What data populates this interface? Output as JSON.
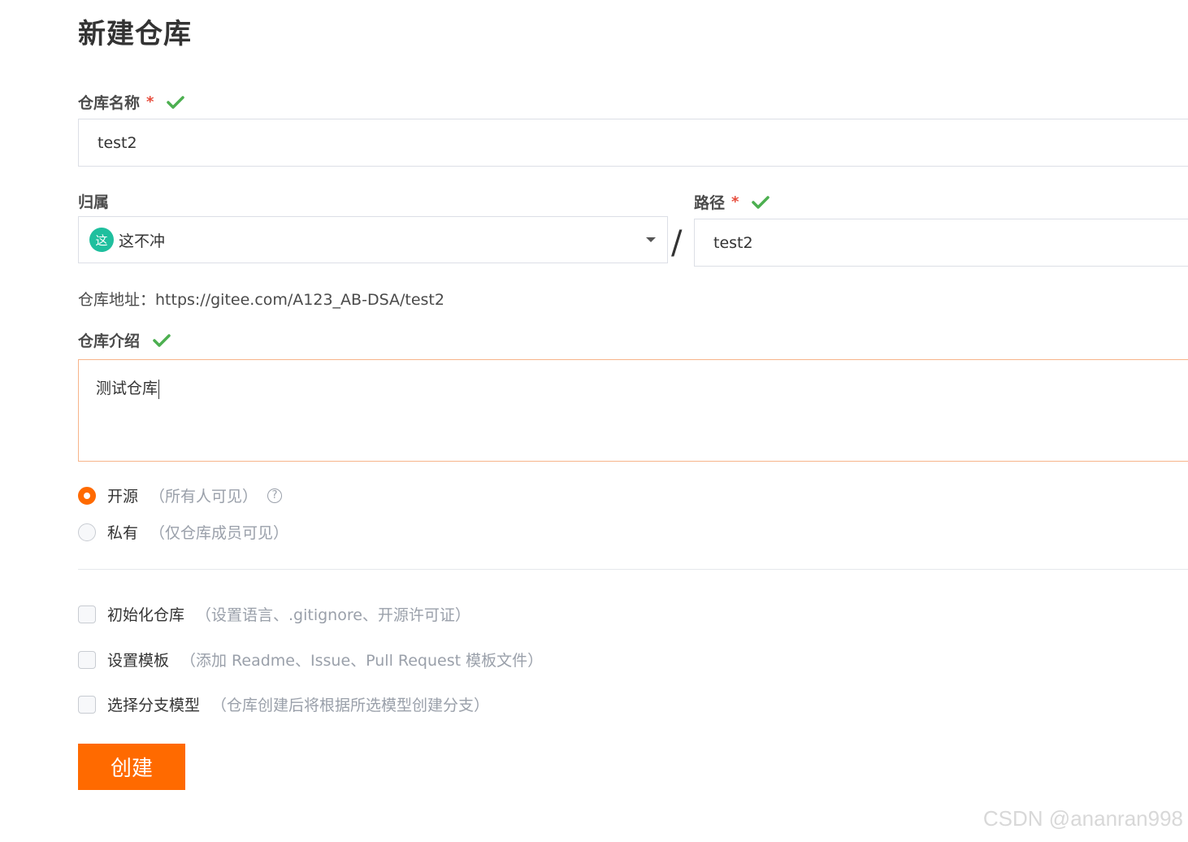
{
  "page": {
    "title": "新建仓库"
  },
  "repo_name": {
    "label": "仓库名称",
    "required_mark": "*",
    "value": "test2"
  },
  "owner": {
    "label": "归属",
    "avatar_text": "这",
    "value": "这不冲"
  },
  "separator": "/",
  "path": {
    "label": "路径",
    "required_mark": "*",
    "value": "test2"
  },
  "address": {
    "text": "仓库地址：https://gitee.com/A123_AB-DSA/test2"
  },
  "description": {
    "label": "仓库介绍",
    "value": "测试仓库"
  },
  "visibility": {
    "options": [
      {
        "label": "开源",
        "hint": "（所有人可见）",
        "selected": true,
        "help_icon": "question-circle-icon"
      },
      {
        "label": "私有",
        "hint": "（仅仓库成员可见）",
        "selected": false
      }
    ]
  },
  "extras": [
    {
      "label": "初始化仓库",
      "hint": "（设置语言、.gitignore、开源许可证）",
      "checked": false
    },
    {
      "label": "设置模板",
      "hint": "（添加 Readme、Issue、Pull Request 模板文件）",
      "checked": false
    },
    {
      "label": "选择分支模型",
      "hint": "（仓库创建后将根据所选模型创建分支）",
      "checked": false
    }
  ],
  "submit": {
    "label": "创建"
  },
  "watermark": "CSDN @ananran998",
  "colors": {
    "accent": "#ff6a00",
    "success": "#4caf50",
    "required": "#e74c3c",
    "avatar": "#1fbf9e"
  }
}
